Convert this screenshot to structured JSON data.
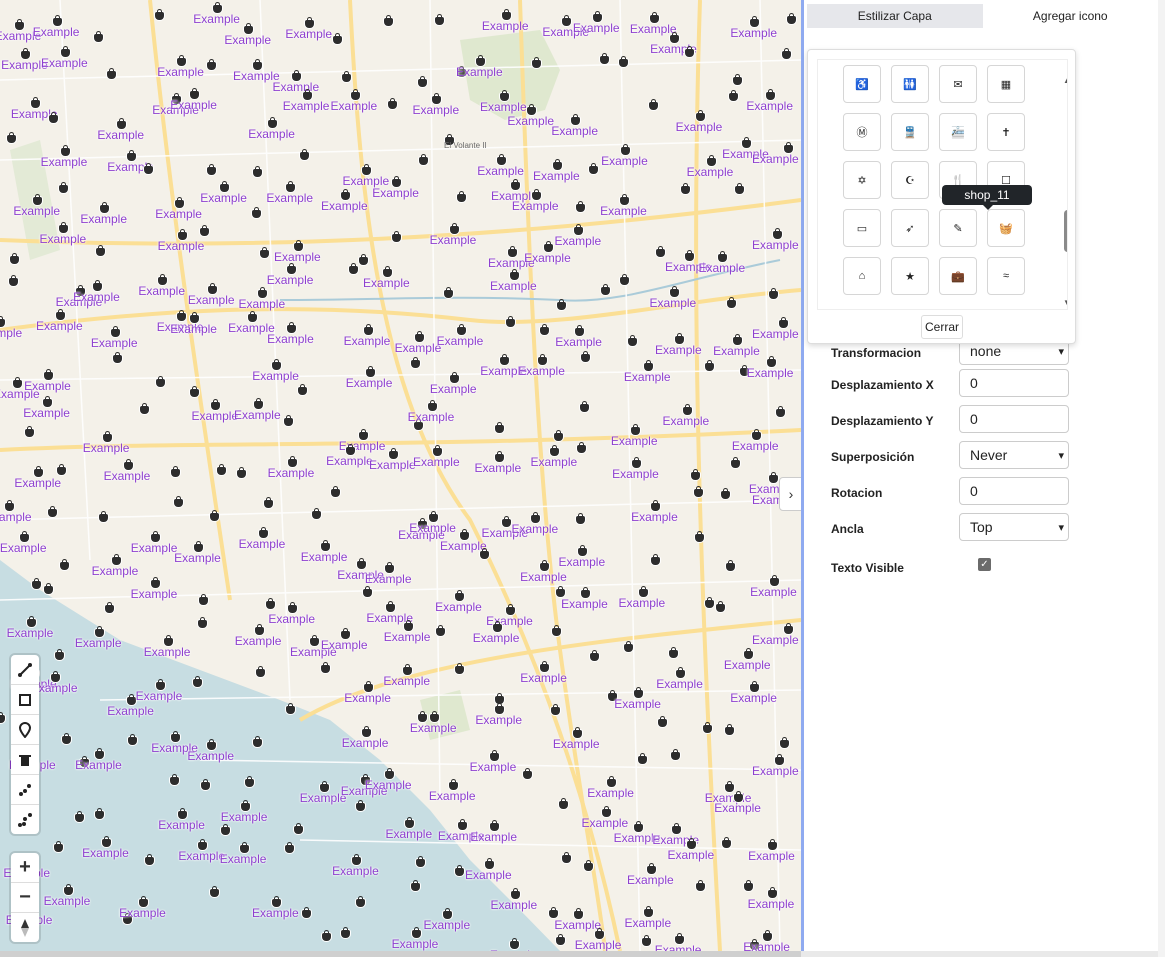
{
  "tabs": {
    "style_layer": "Estilizar Capa",
    "add_icon": "Agregar icono"
  },
  "map": {
    "marker_label": "Example",
    "place_name": "El Volante II"
  },
  "icon_picker": {
    "rows": [
      [
        "wheelchair-icon",
        "toilet-icon",
        "post-icon",
        "building-icon"
      ],
      [
        "rail-metro-icon",
        "rail-icon",
        "rail-light-icon",
        "religious-christian-icon"
      ],
      [
        "religious-jewish-icon",
        "religious-muslim-icon",
        "restaurant-icon",
        "roadblock-icon"
      ],
      [
        "road-shield-icon",
        "rocket-icon",
        "school-icon",
        "shop-icon"
      ],
      [
        "slaughterhouse-icon",
        "star-icon",
        "suitcase-icon",
        "swimming-icon"
      ]
    ],
    "tooltip": "shop_11",
    "close_label": "Cerrar"
  },
  "form": {
    "transform": {
      "label": "Transformacion",
      "value": "none"
    },
    "offset_x": {
      "label": "Desplazamiento X",
      "value": "0"
    },
    "offset_y": {
      "label": "Desplazamiento Y",
      "value": "0"
    },
    "overlap": {
      "label": "Superposición",
      "value": "Never"
    },
    "rotation": {
      "label": "Rotacion",
      "value": "0"
    },
    "anchor": {
      "label": "Ancla",
      "value": "Top"
    },
    "text_visible": {
      "label": "Texto Visible",
      "checked": true
    }
  },
  "colors": {
    "label": "#8e3fcf",
    "accent": "#8faaf0",
    "water": "#c7dde2",
    "park": "#dfe8cf",
    "road": "#fbdf95"
  }
}
